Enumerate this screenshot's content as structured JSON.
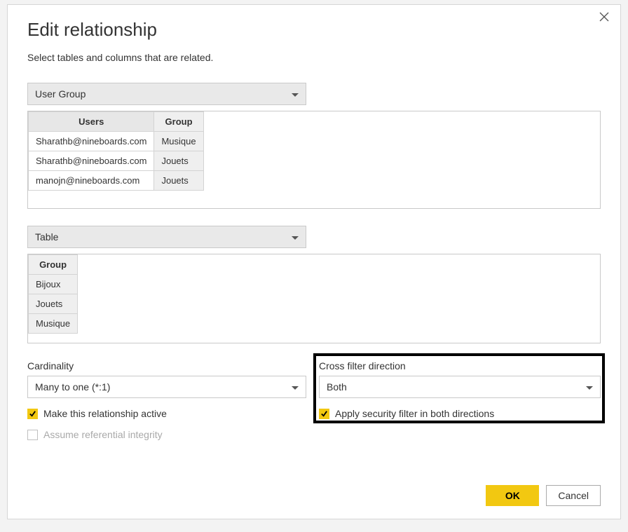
{
  "dialog": {
    "title": "Edit relationship",
    "subtitle": "Select tables and columns that are related."
  },
  "table1": {
    "dropdown": "User Group",
    "headers": [
      "Users",
      "Group"
    ],
    "rows": [
      [
        "Sharathb@nineboards.com",
        "Musique"
      ],
      [
        "Sharathb@nineboards.com",
        "Jouets"
      ],
      [
        "manojn@nineboards.com",
        "Jouets"
      ]
    ]
  },
  "table2": {
    "dropdown": "Table",
    "headers": [
      "Group"
    ],
    "rows": [
      [
        "Bijoux"
      ],
      [
        "Jouets"
      ],
      [
        "Musique"
      ]
    ]
  },
  "cardinality": {
    "label": "Cardinality",
    "value": "Many to one (*:1)"
  },
  "crossfilter": {
    "label": "Cross filter direction",
    "value": "Both"
  },
  "checks": {
    "active": "Make this relationship active",
    "referential": "Assume referential integrity",
    "security": "Apply security filter in both directions"
  },
  "buttons": {
    "ok": "OK",
    "cancel": "Cancel"
  }
}
